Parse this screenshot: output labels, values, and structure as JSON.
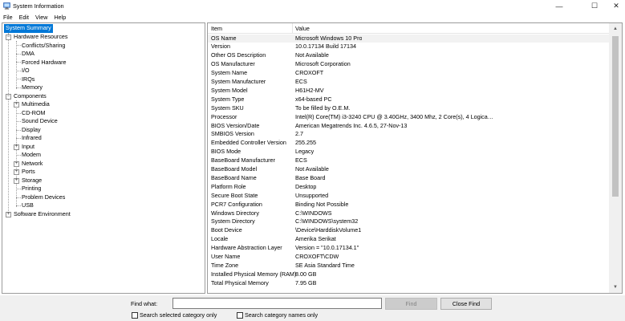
{
  "window": {
    "title": "System Information",
    "icon": "system-information-icon",
    "controls": {
      "minimize": "—",
      "maximize": "☐",
      "close": "✕"
    }
  },
  "menu": [
    "File",
    "Edit",
    "View",
    "Help"
  ],
  "tree": {
    "root": "System Summary",
    "hardware": {
      "label": "Hardware Resources",
      "children": [
        "Conflicts/Sharing",
        "DMA",
        "Forced Hardware",
        "I/O",
        "IRQs",
        "Memory"
      ]
    },
    "components": {
      "label": "Components",
      "children": [
        {
          "label": "Multimedia",
          "expandable": true
        },
        {
          "label": "CD-ROM",
          "expandable": false
        },
        {
          "label": "Sound Device",
          "expandable": false
        },
        {
          "label": "Display",
          "expandable": false
        },
        {
          "label": "Infrared",
          "expandable": false
        },
        {
          "label": "Input",
          "expandable": true
        },
        {
          "label": "Modem",
          "expandable": false
        },
        {
          "label": "Network",
          "expandable": true
        },
        {
          "label": "Ports",
          "expandable": true
        },
        {
          "label": "Storage",
          "expandable": true
        },
        {
          "label": "Printing",
          "expandable": false
        },
        {
          "label": "Problem Devices",
          "expandable": false
        },
        {
          "label": "USB",
          "expandable": false
        }
      ]
    },
    "software": {
      "label": "Software Environment"
    }
  },
  "list": {
    "columns": {
      "item": "Item",
      "value": "Value"
    },
    "rows": [
      {
        "item": "OS Name",
        "value": "Microsoft Windows 10 Pro"
      },
      {
        "item": "Version",
        "value": "10.0.17134 Build 17134"
      },
      {
        "item": "Other OS Description",
        "value": "Not Available"
      },
      {
        "item": "OS Manufacturer",
        "value": "Microsoft Corporation"
      },
      {
        "item": "System Name",
        "value": "CROXOFT"
      },
      {
        "item": "System Manufacturer",
        "value": "ECS"
      },
      {
        "item": "System Model",
        "value": "H61H2-MV"
      },
      {
        "item": "System Type",
        "value": "x64-based PC"
      },
      {
        "item": "System SKU",
        "value": "To be filled by O.E.M."
      },
      {
        "item": "Processor",
        "value": "Intel(R) Core(TM) i3-3240 CPU @ 3.40GHz, 3400 Mhz, 2 Core(s), 4 Logical Pro..."
      },
      {
        "item": "BIOS Version/Date",
        "value": "American Megatrends Inc. 4.6.5, 27-Nov-13"
      },
      {
        "item": "SMBIOS Version",
        "value": "2.7"
      },
      {
        "item": "Embedded Controller Version",
        "value": "255.255"
      },
      {
        "item": "BIOS Mode",
        "value": "Legacy"
      },
      {
        "item": "BaseBoard Manufacturer",
        "value": "ECS"
      },
      {
        "item": "BaseBoard Model",
        "value": "Not Available"
      },
      {
        "item": "BaseBoard Name",
        "value": "Base Board"
      },
      {
        "item": "Platform Role",
        "value": "Desktop"
      },
      {
        "item": "Secure Boot State",
        "value": "Unsupported"
      },
      {
        "item": "PCR7 Configuration",
        "value": "Binding Not Possible"
      },
      {
        "item": "Windows Directory",
        "value": "C:\\WINDOWS"
      },
      {
        "item": "System Directory",
        "value": "C:\\WINDOWS\\system32"
      },
      {
        "item": "Boot Device",
        "value": "\\Device\\HarddiskVolume1"
      },
      {
        "item": "Locale",
        "value": "Amerika Serikat"
      },
      {
        "item": "Hardware Abstraction Layer",
        "value": "Version = \"10.0.17134.1\""
      },
      {
        "item": "User Name",
        "value": "CROXOFT\\CDW"
      },
      {
        "item": "Time Zone",
        "value": "SE Asia Standard Time"
      },
      {
        "item": "Installed Physical Memory (RAM)",
        "value": "8.00 GB"
      },
      {
        "item": "Total Physical Memory",
        "value": "7.95 GB"
      }
    ]
  },
  "find": {
    "label": "Find what:",
    "input_value": "",
    "find_button": "Find",
    "close_button": "Close Find",
    "search_selected": "Search selected category only",
    "search_names": "Search category names only"
  },
  "colors": {
    "selection": "#0078d7",
    "toolbar_bg": "#f0f0f0"
  }
}
